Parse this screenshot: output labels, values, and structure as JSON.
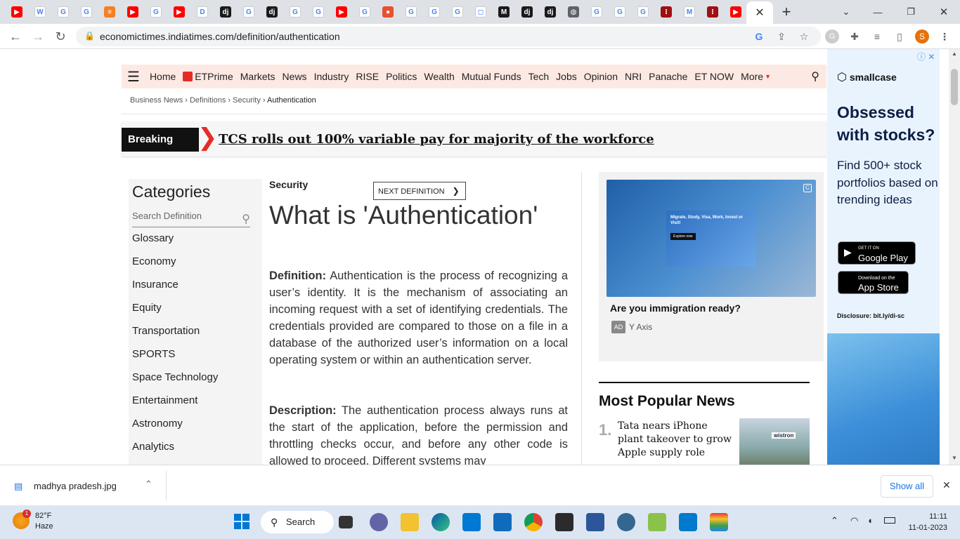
{
  "browser": {
    "url": "economictimes.indiatimes.com/definition/authentication",
    "tabs": [
      {
        "icon": "youtube-icon",
        "color": "#ff0000",
        "glyph": "▶"
      },
      {
        "icon": "wikipedia-icon",
        "color": "#ffffff",
        "glyph": "W"
      },
      {
        "icon": "google-icon",
        "color": "#ffffff",
        "glyph": "G"
      },
      {
        "icon": "google-icon",
        "color": "#ffffff",
        "glyph": "G"
      },
      {
        "icon": "stackoverflow-icon",
        "color": "#f48024",
        "glyph": "≡"
      },
      {
        "icon": "youtube-icon",
        "color": "#ff0000",
        "glyph": "▶"
      },
      {
        "icon": "google-icon",
        "color": "#ffffff",
        "glyph": "G"
      },
      {
        "icon": "youtube-icon",
        "color": "#ff0000",
        "glyph": "▶"
      },
      {
        "icon": "d-icon",
        "color": "#ffffff",
        "glyph": "D"
      },
      {
        "icon": "dj-icon",
        "color": "#1a1a1a",
        "glyph": "dj"
      },
      {
        "icon": "google-icon",
        "color": "#ffffff",
        "glyph": "G"
      },
      {
        "icon": "dj-icon",
        "color": "#1a1a1a",
        "glyph": "dj"
      },
      {
        "icon": "google-icon",
        "color": "#ffffff",
        "glyph": "G"
      },
      {
        "icon": "google-icon",
        "color": "#ffffff",
        "glyph": "G"
      },
      {
        "icon": "youtube-icon",
        "color": "#ff0000",
        "glyph": "▶"
      },
      {
        "icon": "google-icon",
        "color": "#ffffff",
        "glyph": "G"
      },
      {
        "icon": "read-icon",
        "color": "#e8502e",
        "glyph": "●"
      },
      {
        "icon": "google-icon",
        "color": "#ffffff",
        "glyph": "G"
      },
      {
        "icon": "google-icon",
        "color": "#ffffff",
        "glyph": "G"
      },
      {
        "icon": "google-icon",
        "color": "#ffffff",
        "glyph": "G"
      },
      {
        "icon": "cube-icon",
        "color": "#ffffff",
        "glyph": "◻"
      },
      {
        "icon": "medium-icon",
        "color": "#1a1a1a",
        "glyph": "M"
      },
      {
        "icon": "dj-icon",
        "color": "#1a1a1a",
        "glyph": "dj"
      },
      {
        "icon": "dj-icon",
        "color": "#1a1a1a",
        "glyph": "dj"
      },
      {
        "icon": "globe-icon",
        "color": "#5f6368",
        "glyph": "◍"
      },
      {
        "icon": "google-icon",
        "color": "#ffffff",
        "glyph": "G"
      },
      {
        "icon": "google-icon",
        "color": "#ffffff",
        "glyph": "G"
      },
      {
        "icon": "google-icon",
        "color": "#ffffff",
        "glyph": "G"
      },
      {
        "icon": "dots-icon",
        "color": "#a01010",
        "glyph": "⁝"
      },
      {
        "icon": "gmail-icon",
        "color": "#ffffff",
        "glyph": "M"
      },
      {
        "icon": "dots-icon",
        "color": "#a01010",
        "glyph": "⁝"
      },
      {
        "icon": "youtube-icon",
        "color": "#ff0000",
        "glyph": "▶"
      }
    ],
    "profile_initial": "S"
  },
  "nav": {
    "items": [
      "Home",
      "ETPrime",
      "Markets",
      "News",
      "Industry",
      "RISE",
      "Politics",
      "Wealth",
      "Mutual Funds",
      "Tech",
      "Jobs",
      "Opinion",
      "NRI",
      "Panache",
      "ET NOW",
      "More"
    ]
  },
  "breadcrumb": [
    "Business News",
    "Definitions",
    "Security",
    "Authentication"
  ],
  "breaking": {
    "label": "Breaking",
    "headline": "TCS rolls out 100% variable pay for majority of the workforce"
  },
  "categories": {
    "title": "Categories",
    "search_placeholder": "Search Definition",
    "items": [
      "Glossary",
      "Economy",
      "Insurance",
      "Equity",
      "Transportation",
      "SPORTS",
      "Space Technology",
      "Entertainment",
      "Astronomy",
      "Analytics"
    ]
  },
  "article": {
    "category": "Security",
    "next_label": "NEXT DEFINITION",
    "title": "What is 'Authentication'",
    "definition_label": "Definition:",
    "definition_text": "Authentication is the process of recognizing a user’s identity. It is the mechanism of associating an incoming request with a set of identifying credentials. The credentials provided are compared to those on a file in a database of the authorized user’s information on a local operating system or within an authentication server.",
    "description_label": "Description:",
    "description_text": "The authentication process always runs at the start of the application, before the permission and throttling checks occur, and before any other code is allowed to proceed. Different systems may"
  },
  "ad": {
    "inner_text": "Migrate, Study, Visa, Work, Invest or Visit!",
    "inner_cta": "Explore now",
    "title": "Are you immigration ready?",
    "badge": "AD",
    "advertiser": "Y Axis"
  },
  "popular": {
    "title": "Most Popular News",
    "items": [
      {
        "num": "1.",
        "text": "Tata nears iPhone plant takeover to grow Apple supply role",
        "thumb_label": "wistron"
      }
    ]
  },
  "sidead": {
    "brand": "smallcase",
    "headline": "Obsessed with stocks?",
    "sub": "Find 500+ stock portfolios based on trending ideas",
    "google_play_top": "GET IT ON",
    "google_play": "Google Play",
    "app_store_top": "Download on the",
    "app_store": "App Store",
    "disclosure": "Disclosure: bit.ly/di-sc"
  },
  "downloads": {
    "file": "madhya pradesh.jpg",
    "show_all": "Show all"
  },
  "taskbar": {
    "temp": "82°F",
    "condition": "Haze",
    "search_label": "Search",
    "time": "11:11",
    "date": "11-01-2023",
    "badge_count": "1"
  }
}
